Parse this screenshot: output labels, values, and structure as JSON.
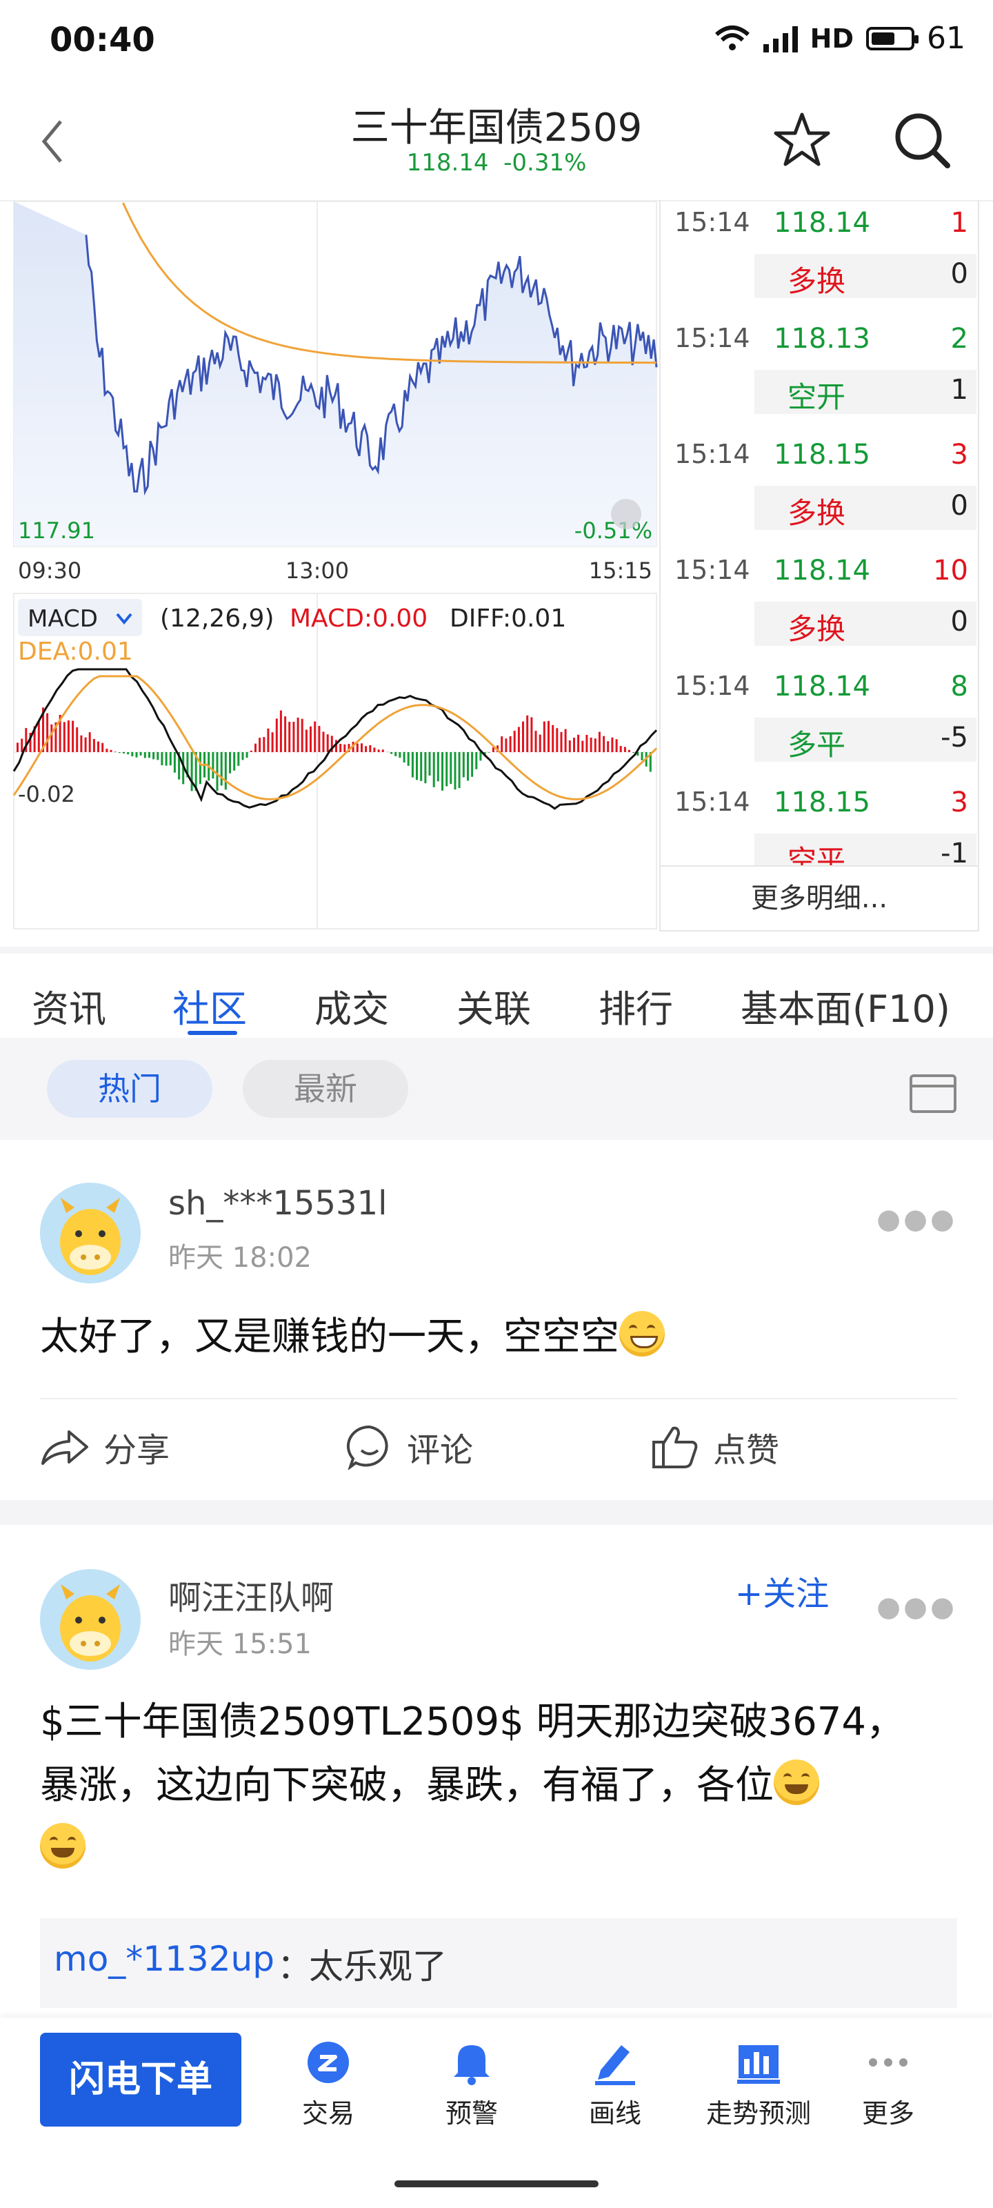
{
  "status_bar": {
    "time": "00:40",
    "network": "5G",
    "hd": "HD",
    "battery": "61",
    "battery_level": 0.61
  },
  "header": {
    "title": "三十年国债2509",
    "price": "118.14",
    "change_pct": "-0.31%"
  },
  "chart": {
    "price_low_label": "117.91",
    "pct_low_label": "-0.51%",
    "time_labels": [
      "09:30",
      "13:00",
      "15:15"
    ],
    "indicator": {
      "name": "MACD",
      "params": "(12,26,9)",
      "macd_label": "MACD:0.00",
      "diff_label": "DIFF:0.01",
      "dea_label": "DEA:0.01",
      "axis_label": "-0.02"
    },
    "colors": {
      "price_line": "#3b55b5",
      "avg_line": "#f0a338",
      "up": "#e0141e",
      "down": "#139a36"
    }
  },
  "ticks": {
    "rows": [
      {
        "time": "15:14",
        "price": "118.14",
        "price_dir": "dn",
        "vol": "1",
        "vol_dir": "up",
        "type": "多换",
        "type_dir": "up",
        "chg": "0"
      },
      {
        "time": "15:14",
        "price": "118.13",
        "price_dir": "dn",
        "vol": "2",
        "vol_dir": "dn",
        "type": "空开",
        "type_dir": "dn",
        "chg": "1"
      },
      {
        "time": "15:14",
        "price": "118.15",
        "price_dir": "dn",
        "vol": "3",
        "vol_dir": "up",
        "type": "多换",
        "type_dir": "up",
        "chg": "0"
      },
      {
        "time": "15:14",
        "price": "118.14",
        "price_dir": "dn",
        "vol": "10",
        "vol_dir": "up",
        "type": "多换",
        "type_dir": "up",
        "chg": "0"
      },
      {
        "time": "15:14",
        "price": "118.14",
        "price_dir": "dn",
        "vol": "8",
        "vol_dir": "dn",
        "type": "多平",
        "type_dir": "dn",
        "chg": "-5"
      },
      {
        "time": "15:14",
        "price": "118.15",
        "price_dir": "dn",
        "vol": "3",
        "vol_dir": "up",
        "type": "空平",
        "type_dir": "up",
        "chg": "-1"
      }
    ],
    "more_label": "更多明细..."
  },
  "tabs": {
    "items": [
      "资讯",
      "社区",
      "成交",
      "关联",
      "排行",
      "基本面(F10)"
    ],
    "active": 1
  },
  "filters": {
    "hot": "热门",
    "latest": "最新"
  },
  "posts": [
    {
      "user": "sh_***15531l",
      "time": "昨天 18:02",
      "content": "太好了，又是赚钱的一天，空空空",
      "actions": {
        "share": "分享",
        "comment": "评论",
        "like": "点赞"
      }
    },
    {
      "user": "啊汪汪队啊",
      "time": "昨天 15:51",
      "follow": "+关注",
      "content_line1": "$三十年国债2509TL2509$ 明天那边突破3674，",
      "content_line2": "暴涨，这边向下突破，暴跌，有福了，各位",
      "comment_user": "mo_*1132up",
      "comment_sep": "：",
      "comment_text": "太乐观了"
    }
  ],
  "bottom_bar": {
    "flash_order": "闪电下单",
    "items": [
      "交易",
      "预警",
      "画线",
      "走势预测",
      "更多"
    ]
  }
}
